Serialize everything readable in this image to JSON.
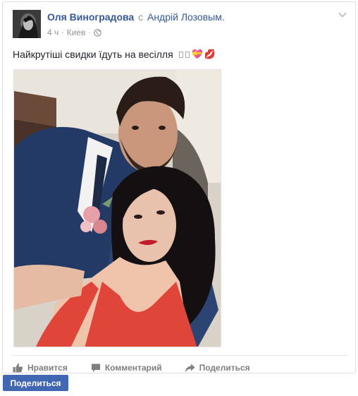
{
  "post": {
    "author": "Оля Виноградова",
    "with_word": "с",
    "tagged_user": "Андрій Лозовым.",
    "time": "4 ч",
    "separator": "·",
    "location": "Киев",
    "text": "Найкрутіші свидки їдуть на весілля",
    "emoji": [
      "unknown-glyph",
      "unknown-glyph",
      "heart-ribbon",
      "kiss-mark"
    ],
    "photo_icon": "couple-selfie-photo"
  },
  "actions": {
    "like": "Нравится",
    "comment": "Комментарий",
    "share": "Поделиться"
  },
  "share_button": {
    "label": "Поделиться"
  },
  "colors": {
    "link": "#365899",
    "meta": "#90949c",
    "button": "#4267b2",
    "action_text": "#7f7f7f"
  }
}
